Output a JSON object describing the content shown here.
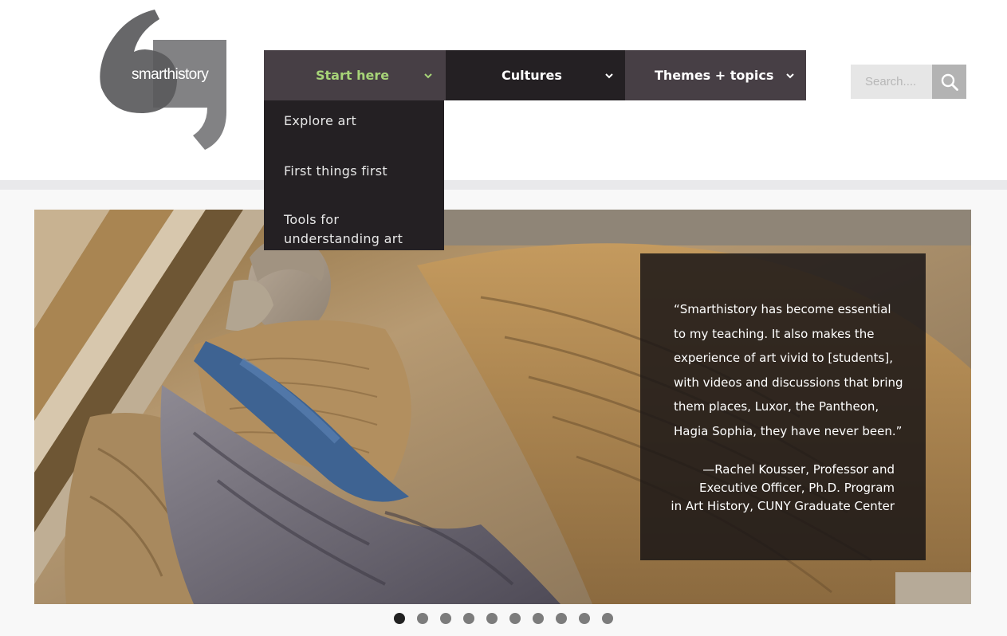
{
  "logo": {
    "text": "smarthistory",
    "icon": "quote-marks-logo"
  },
  "nav": {
    "items": [
      {
        "label": "Start here",
        "icon": "chevron-down-icon",
        "active": true
      },
      {
        "label": "Cultures",
        "icon": "chevron-down-icon",
        "active": false
      },
      {
        "label": "Themes + topics",
        "icon": "chevron-down-icon",
        "active": false
      }
    ],
    "dropdown": [
      {
        "label": "Explore art"
      },
      {
        "label": "First things first"
      },
      {
        "label": "Tools for\nunderstanding art"
      }
    ]
  },
  "search": {
    "placeholder": "Search....",
    "icon": "search-icon"
  },
  "hero": {
    "image": "sculpted-angel-relief",
    "quote": "“Smarthistory has become essential\nto my teaching. It also makes the\nexperience of art vivid to [students],\nwith videos and discussions that bring\nthem places, Luxor, the Pantheon,\nHagia Sophia, they have never been.”",
    "attribution": "—Rachel Kousser, Professor and\nExecutive Officer, Ph.D. Program\nin Art History, CUNY Graduate Center"
  },
  "carousel": {
    "slides": 10,
    "active_index": 0
  },
  "colors": {
    "nav_dark": "#242023",
    "nav_mid": "#473f45",
    "nav_active_text": "#a7d478",
    "divider": "#e9e9eb"
  }
}
